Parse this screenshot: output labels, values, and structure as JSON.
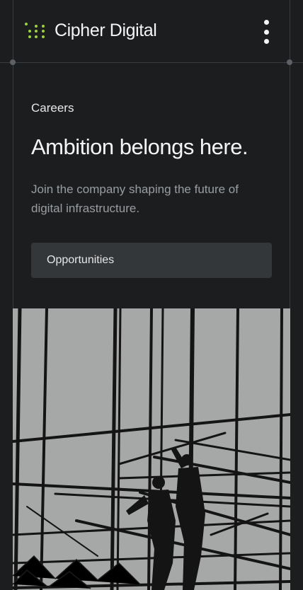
{
  "brand": {
    "name": "Cipher Digital",
    "logo_icon": "dot-grid-icon",
    "accent": "#9fd13a"
  },
  "header": {
    "menu_icon": "kebab-menu-icon"
  },
  "hero": {
    "eyebrow": "Careers",
    "headline": "Ambition belongs here.",
    "subtext": "Join the company shaping the future of digital infrastructure.",
    "cta_label": "Opportunities"
  },
  "image": {
    "subject": "workers-on-scaffolding-photo"
  },
  "colors": {
    "background": "#1b1d1f",
    "button": "#34373a",
    "muted_text": "#9a9da0"
  }
}
